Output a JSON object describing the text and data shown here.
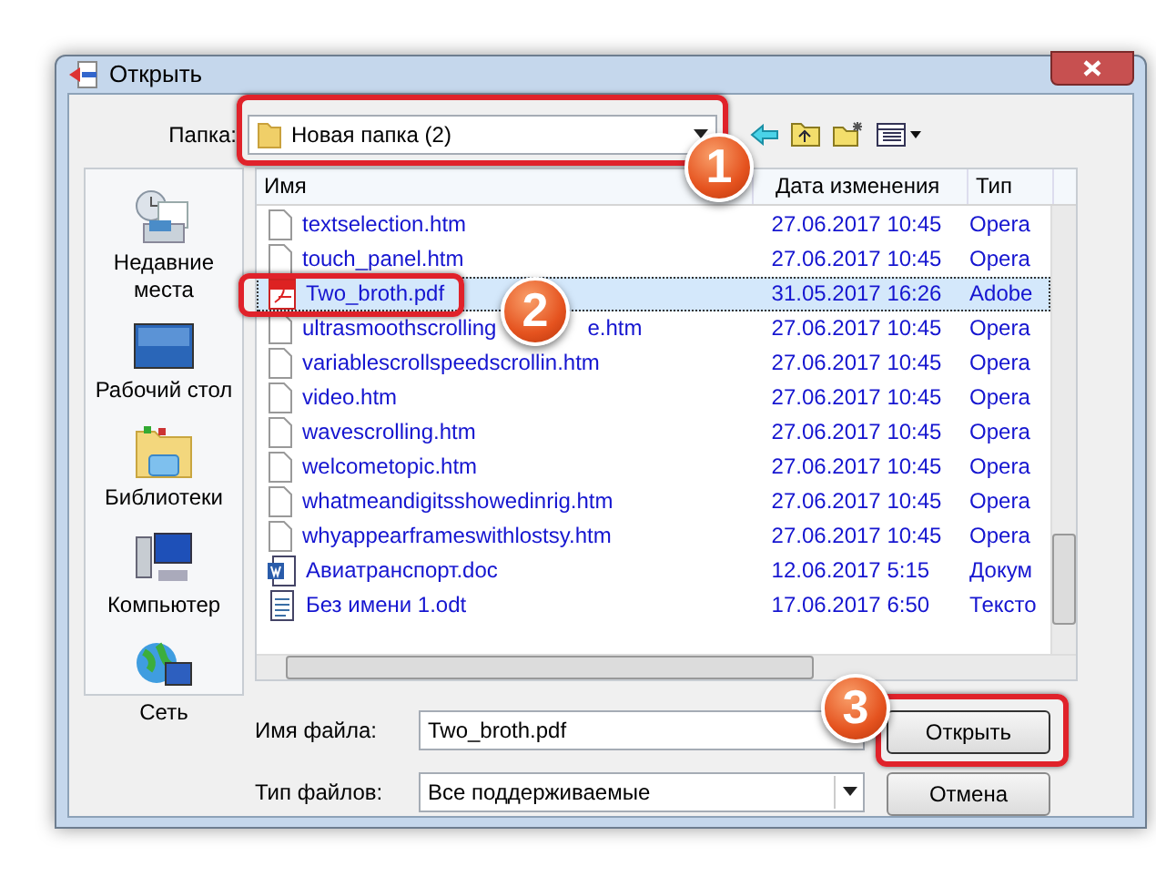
{
  "window": {
    "title": "Открыть"
  },
  "folder": {
    "label": "Папка:",
    "value": "Новая папка (2)"
  },
  "places": [
    {
      "label": "Недавние места",
      "kind": "recent"
    },
    {
      "label": "Рабочий стол",
      "kind": "desktop"
    },
    {
      "label": "Библиотеки",
      "kind": "libraries"
    },
    {
      "label": "Компьютер",
      "kind": "computer"
    },
    {
      "label": "Сеть",
      "kind": "network"
    }
  ],
  "table": {
    "columns": [
      "Имя",
      "Дата изменения",
      "Тип"
    ],
    "rows": [
      {
        "name": "textselection.htm",
        "date": "27.06.2017 10:45",
        "type": "Opera",
        "kind": "htm",
        "selected": false
      },
      {
        "name": "touch_panel.htm",
        "date": "27.06.2017 10:45",
        "type": "Opera",
        "kind": "htm",
        "selected": false
      },
      {
        "name": "Two_broth.pdf",
        "date": "31.05.2017 16:26",
        "type": "Adobe",
        "kind": "pdf",
        "selected": true
      },
      {
        "name": "ultrasmoothscrolling",
        "name_end": "e.htm",
        "date": "27.06.2017 10:45",
        "type": "Opera",
        "kind": "htm",
        "selected": false
      },
      {
        "name": "variablescrollspeedscrollin.htm",
        "date": "27.06.2017 10:45",
        "type": "Opera",
        "kind": "htm",
        "selected": false
      },
      {
        "name": "video.htm",
        "date": "27.06.2017 10:45",
        "type": "Opera",
        "kind": "htm",
        "selected": false
      },
      {
        "name": "wavescrolling.htm",
        "date": "27.06.2017 10:45",
        "type": "Opera",
        "kind": "htm",
        "selected": false
      },
      {
        "name": "welcometopic.htm",
        "date": "27.06.2017 10:45",
        "type": "Opera",
        "kind": "htm",
        "selected": false
      },
      {
        "name": "whatmeandigitsshowedinrig.htm",
        "date": "27.06.2017 10:45",
        "type": "Opera",
        "kind": "htm",
        "selected": false
      },
      {
        "name": "whyappearframeswithlostsy.htm",
        "date": "27.06.2017 10:45",
        "type": "Opera",
        "kind": "htm",
        "selected": false
      },
      {
        "name": "Авиатранспорт.doc",
        "date": "12.06.2017 5:15",
        "type": "Докум",
        "kind": "doc",
        "selected": false
      },
      {
        "name": "Без имени 1.odt",
        "date": "17.06.2017 6:50",
        "type": "Тексто",
        "kind": "odt",
        "selected": false
      }
    ]
  },
  "file_name": {
    "label": "Имя файла:",
    "value": "Two_broth.pdf"
  },
  "file_type": {
    "label": "Тип файлов:",
    "value": "Все поддерживаемые"
  },
  "buttons": [
    "Открыть",
    "Отмена"
  ],
  "annotations": [
    "1",
    "2",
    "3"
  ]
}
